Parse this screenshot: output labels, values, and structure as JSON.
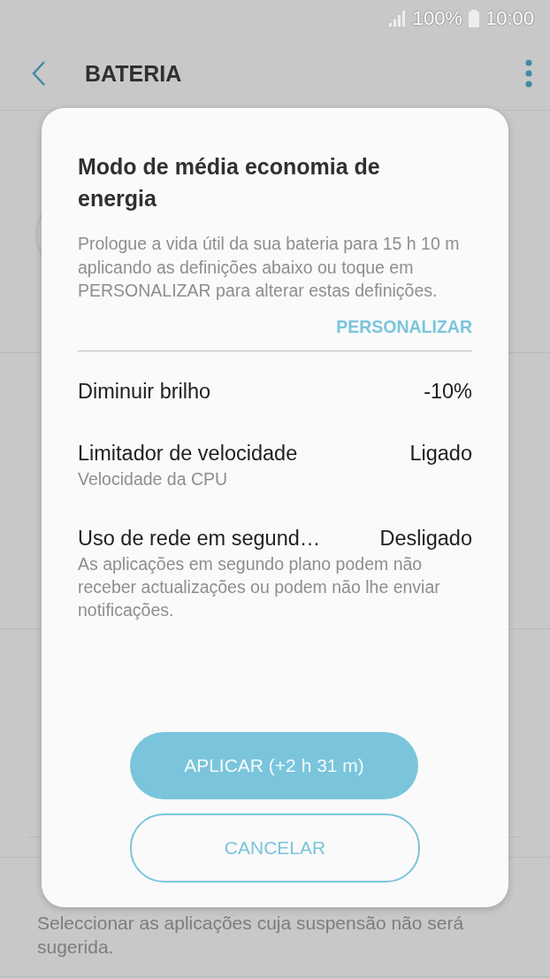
{
  "status_bar": {
    "battery_text": "100%",
    "time": "10:00"
  },
  "app_bar": {
    "title": "BATERIA"
  },
  "background_items": [
    {
      "description": "Seleccionar as aplicações cuja suspensão não será sugerida."
    }
  ],
  "dialog": {
    "title": "Modo de média economia de energia",
    "description": "Prologue a vida útil da sua bateria para 15 h 10 m aplicando as definições abaixo ou toque em PERSONALIZAR para alterar estas definições.",
    "link": "PERSONALIZAR",
    "settings": [
      {
        "label": "Diminuir brilho",
        "value": "-10%"
      },
      {
        "label": "Limitador de velocidade",
        "value": "Ligado",
        "description": "Velocidade da CPU"
      },
      {
        "label": "Uso de rede em segund…",
        "value": "Desligado",
        "description": "As aplicações em segundo plano podem não receber actualizações ou podem não lhe enviar notificações."
      }
    ],
    "buttons": [
      {
        "label": "APLICAR (+2 h 31 m)",
        "kind": "primary"
      },
      {
        "label": "CANCELAR",
        "kind": "outline"
      }
    ]
  }
}
